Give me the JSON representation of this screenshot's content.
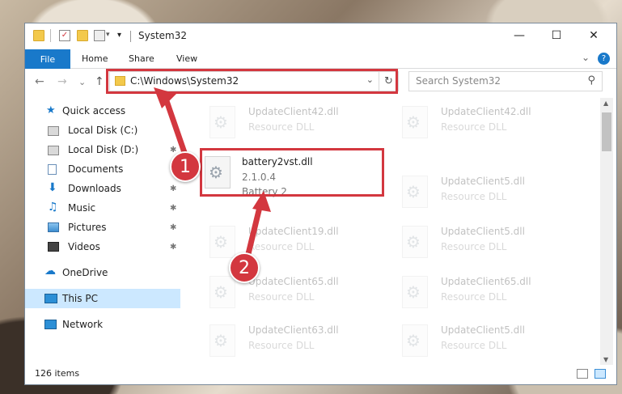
{
  "window": {
    "title": "System32",
    "controls": {
      "minimize": "—",
      "maximize": "☐",
      "close": "✕"
    }
  },
  "ribbon": {
    "file": "File",
    "tabs": [
      "Home",
      "Share",
      "View"
    ],
    "expand_icon": "⌄",
    "help_icon": "?"
  },
  "address_bar": {
    "path": "C:\\Windows\\System32",
    "chevron": "⌄",
    "refresh": "↻",
    "nav": {
      "back": "←",
      "forward": "→",
      "recent": "⌄",
      "up": "↑"
    }
  },
  "search": {
    "placeholder": "Search System32",
    "icon": "⚲"
  },
  "sidebar": {
    "quick_access": "Quick access",
    "items": [
      {
        "label": "Local Disk (C:)",
        "pin": ""
      },
      {
        "label": "Local Disk (D:)",
        "pin": "✱"
      },
      {
        "label": "Documents",
        "pin": "✱"
      },
      {
        "label": "Downloads",
        "pin": "✱"
      },
      {
        "label": "Music",
        "pin": "✱"
      },
      {
        "label": "Pictures",
        "pin": "✱"
      },
      {
        "label": "Videos",
        "pin": "✱"
      }
    ],
    "onedrive": "OneDrive",
    "this_pc": "This PC",
    "network": "Network"
  },
  "files": {
    "highlighted": {
      "name": "battery2vst.dll",
      "version": "2.1.0.4",
      "description": "Battery 2"
    },
    "tiles": [
      {
        "name": "UpdateClient42.dll",
        "desc": "Resource DLL"
      },
      {
        "name": "UpdateClient42.dll",
        "desc": "Resource DLL"
      },
      {
        "name": "UpdateClient5.dll",
        "desc": "Resource DLL"
      },
      {
        "name": "UpdateClient19.dll",
        "desc": "Resource DLL"
      },
      {
        "name": "UpdateClient5.dll",
        "desc": "Resource DLL"
      },
      {
        "name": "UpdateClient65.dll",
        "desc": "Resource DLL"
      },
      {
        "name": "UpdateClient65.dll",
        "desc": "Resource DLL"
      },
      {
        "name": "UpdateClient63.dll",
        "desc": "Resource DLL"
      },
      {
        "name": "UpdateClient5.dll",
        "desc": "Resource DLL"
      }
    ]
  },
  "status": {
    "item_count": "126 items"
  },
  "annotations": {
    "step1": "1",
    "step2": "2"
  },
  "colors": {
    "accent": "#1979ca",
    "highlight": "#d3373f",
    "selected": "#cce8ff"
  }
}
